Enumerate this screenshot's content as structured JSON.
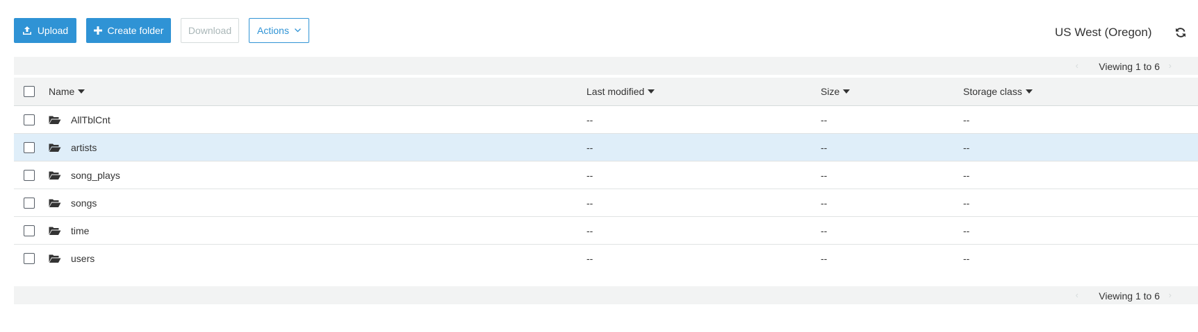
{
  "toolbar": {
    "upload_label": "Upload",
    "create_folder_label": "Create folder",
    "download_label": "Download",
    "actions_label": "Actions"
  },
  "region": "US West (Oregon)",
  "pager": {
    "top_text": "Viewing 1 to 6",
    "bottom_text": "Viewing 1 to 6"
  },
  "table": {
    "headers": {
      "name": "Name",
      "last_modified": "Last modified",
      "size": "Size",
      "storage_class": "Storage class"
    },
    "rows": [
      {
        "name": "AllTblCnt",
        "last_modified": "--",
        "size": "--",
        "storage_class": "--",
        "selected": false
      },
      {
        "name": "artists",
        "last_modified": "--",
        "size": "--",
        "storage_class": "--",
        "selected": true
      },
      {
        "name": "song_plays",
        "last_modified": "--",
        "size": "--",
        "storage_class": "--",
        "selected": false
      },
      {
        "name": "songs",
        "last_modified": "--",
        "size": "--",
        "storage_class": "--",
        "selected": false
      },
      {
        "name": "time",
        "last_modified": "--",
        "size": "--",
        "storage_class": "--",
        "selected": false
      },
      {
        "name": "users",
        "last_modified": "--",
        "size": "--",
        "storage_class": "--",
        "selected": false
      }
    ]
  },
  "icons": {
    "upload": "upload-icon",
    "create_folder": "plus-icon",
    "actions": "chevron-down-icon",
    "refresh": "refresh-icon",
    "folder": "folder-open-icon",
    "sort": "caret-down-icon"
  },
  "colors": {
    "primary": "#2f93d5",
    "selected_row": "#dfeef9",
    "bar_background": "#f2f3f3"
  }
}
